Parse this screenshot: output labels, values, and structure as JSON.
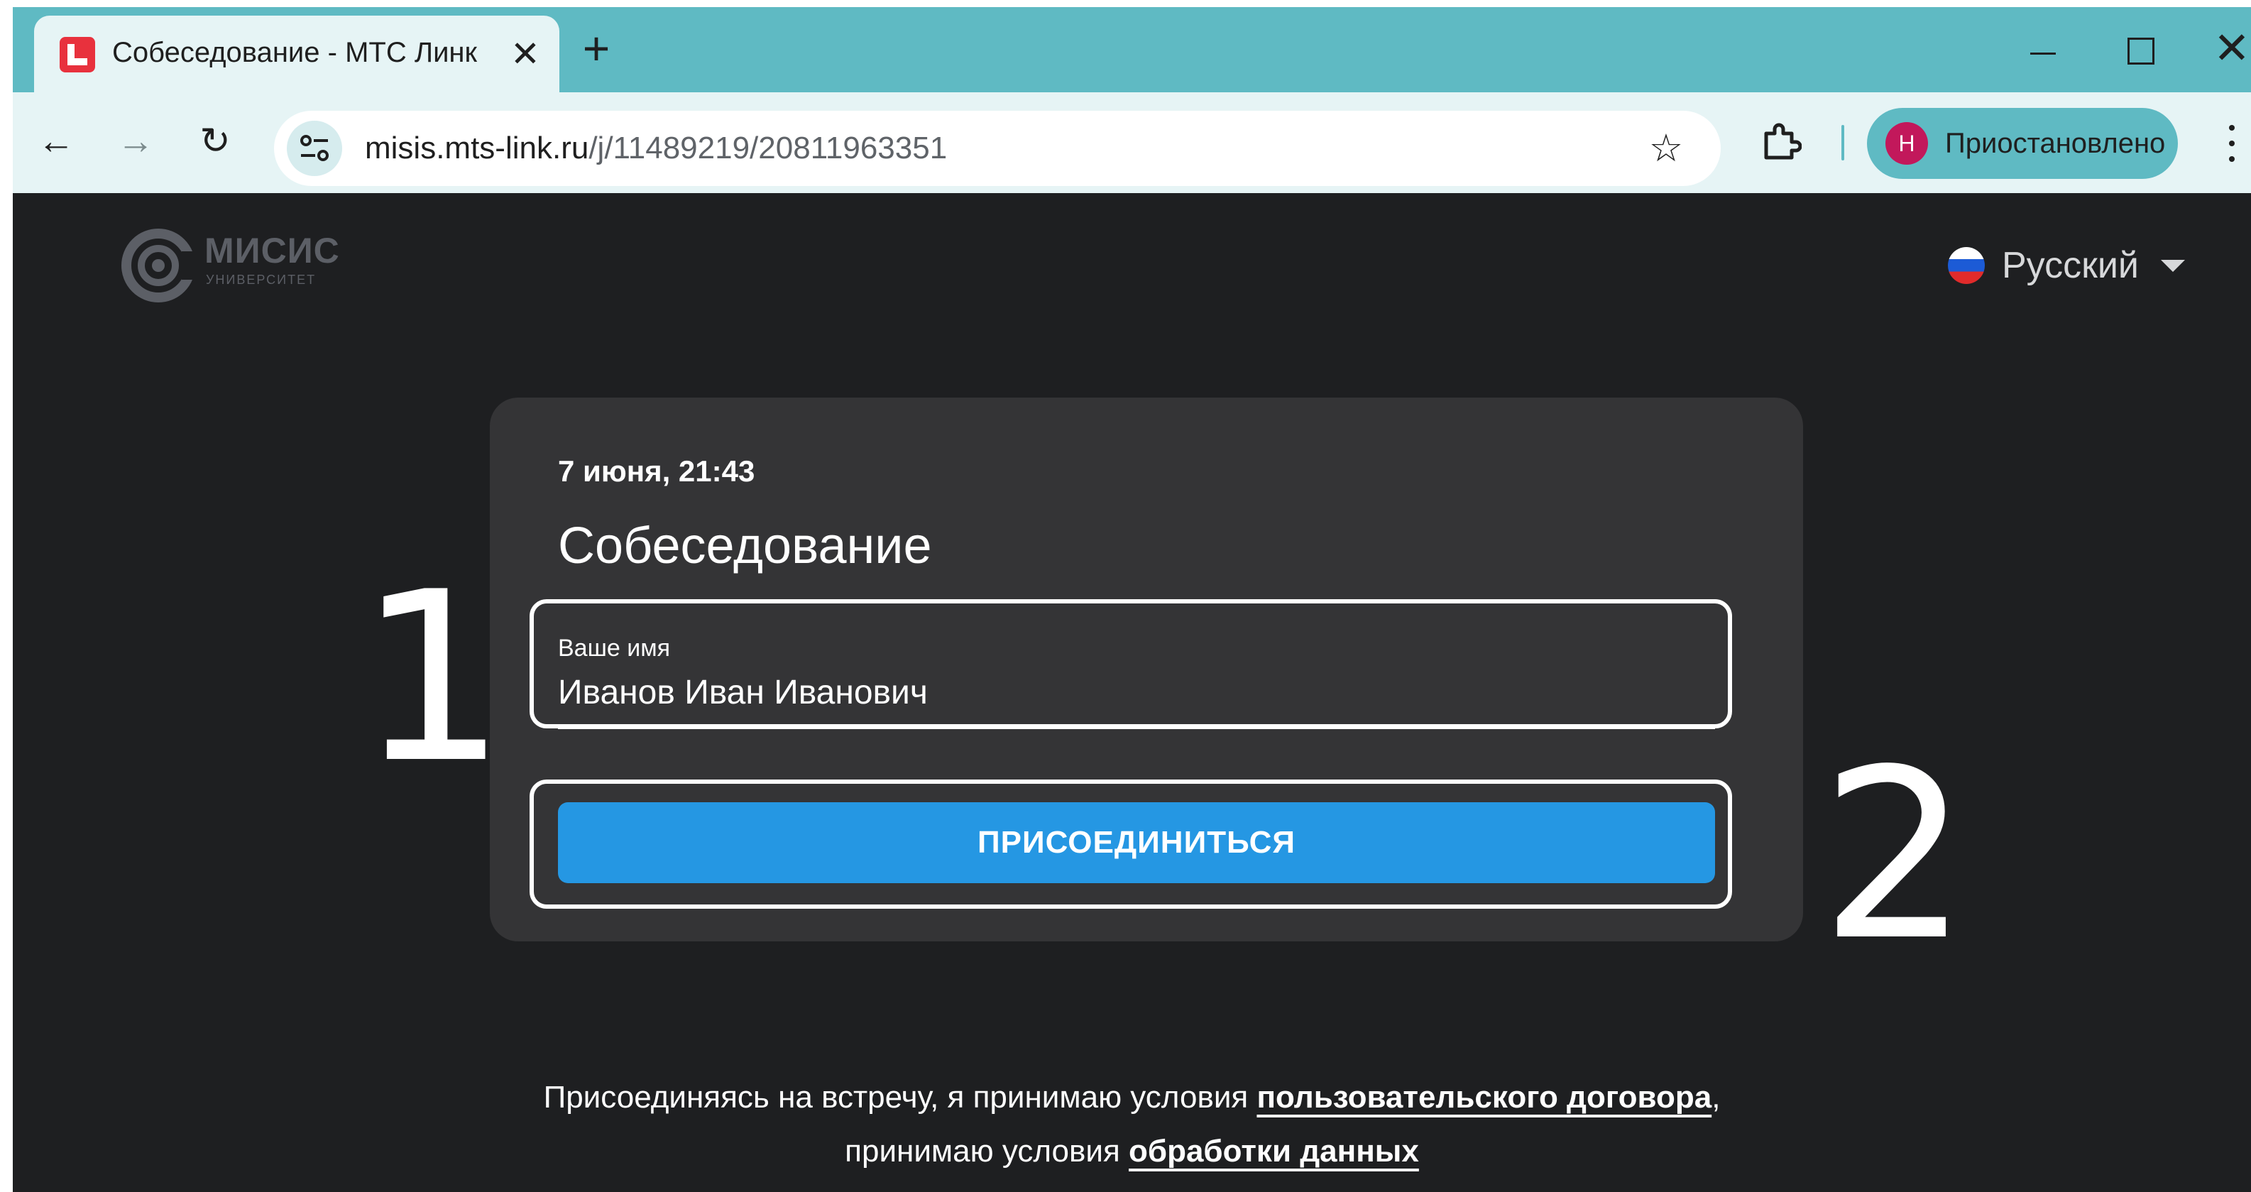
{
  "browser": {
    "tab": {
      "title": "Собеседование - МТС Линк",
      "close": "✕"
    },
    "new_tab": "+",
    "nav": {
      "back": "←",
      "forward": "→",
      "reload": "↻"
    },
    "address": {
      "host": "misis.mts-link.ru",
      "path": "/j/11489219/20811963351"
    },
    "bookmark": "☆",
    "window_close": "✕",
    "profile": {
      "initial": "Н",
      "label": "Приостановлено"
    }
  },
  "header": {
    "logo": {
      "name": "МИСИС",
      "subtitle": "УНИВЕРСИТЕТ"
    },
    "language": "Русский"
  },
  "card": {
    "date": "7 июня, 21:43",
    "title": "Собеседование",
    "name_label": "Ваше имя",
    "name_value": "Иванов Иван Иванович",
    "join_label": "ПРИСОЕДИНИТЬСЯ"
  },
  "annotations": {
    "first": "1",
    "second": "2"
  },
  "terms": {
    "part1": "Присоединяясь на встречу, я принимаю условия ",
    "link1": "пользовательского договора",
    "part2": ",",
    "part3": "принимаю условия ",
    "link2": "обработки данных"
  },
  "colors": {
    "accent": "#2597e3",
    "page_bg": "#1e1f21",
    "card_bg": "#343436",
    "chrome": "#5fbac3"
  }
}
